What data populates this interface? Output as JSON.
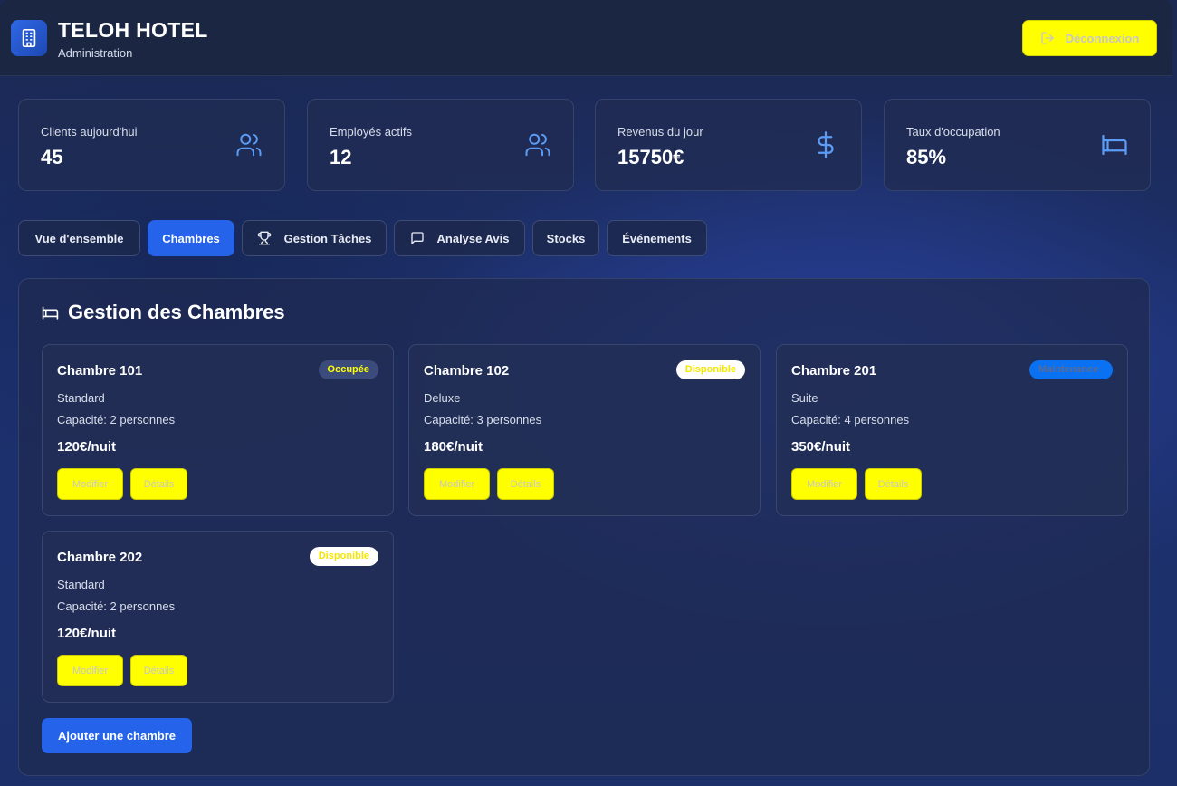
{
  "header": {
    "title": "TELOH HOTEL",
    "subtitle": "Administration",
    "logout_label": "Déconnexion"
  },
  "stats": [
    {
      "label": "Clients aujourd'hui",
      "value": "45",
      "icon": "users-icon"
    },
    {
      "label": "Employés actifs",
      "value": "12",
      "icon": "users-icon"
    },
    {
      "label": "Revenus du jour",
      "value": "15750€",
      "icon": "dollar-icon"
    },
    {
      "label": "Taux d'occupation",
      "value": "85%",
      "icon": "bed-icon"
    }
  ],
  "tabs": [
    {
      "label": "Vue d'ensemble",
      "active": false
    },
    {
      "label": "Chambres",
      "active": true
    },
    {
      "label": "Gestion Tâches",
      "icon": "trophy-icon",
      "active": false
    },
    {
      "label": "Analyse Avis",
      "icon": "message-icon",
      "active": false
    },
    {
      "label": "Stocks",
      "active": false
    },
    {
      "label": "Événements",
      "active": false
    }
  ],
  "panel": {
    "title": "Gestion des Chambres",
    "add_label": "Ajouter une chambre"
  },
  "rooms": [
    {
      "name": "Chambre 101",
      "status": "Occupée",
      "type": "Standard",
      "capacity": "Capacité: 2 personnes",
      "price": "120€/nuit",
      "edit": "Modifier",
      "details": "Détails"
    },
    {
      "name": "Chambre 102",
      "status": "Disponible",
      "type": "Deluxe",
      "capacity": "Capacité: 3 personnes",
      "price": "180€/nuit",
      "edit": "Modifier",
      "details": "Détails"
    },
    {
      "name": "Chambre 201",
      "status": "Maintenance",
      "type": "Suite",
      "capacity": "Capacité: 4 personnes",
      "price": "350€/nuit",
      "edit": "Modifier",
      "details": "Détails"
    },
    {
      "name": "Chambre 202",
      "status": "Disponible",
      "type": "Standard",
      "capacity": "Capacité: 2 personnes",
      "price": "120€/nuit",
      "edit": "Modifier",
      "details": "Détails"
    }
  ],
  "colors": {
    "accent": "#2563eb",
    "icon_blue": "#5b9cf6",
    "button_yellow": "#ffff00"
  }
}
